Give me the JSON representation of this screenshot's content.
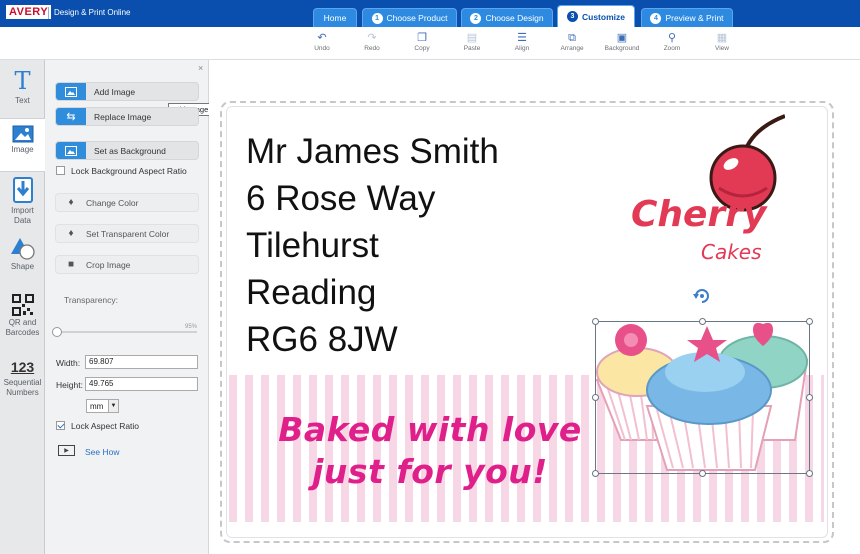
{
  "header": {
    "logo": "AVERY",
    "app_title": "Design & Print Online",
    "tabs": [
      {
        "label": "Home",
        "num": ""
      },
      {
        "label": "Choose Product",
        "num": "1"
      },
      {
        "label": "Choose Design",
        "num": "2"
      },
      {
        "label": "Customize",
        "num": "3"
      },
      {
        "label": "Preview & Print",
        "num": "4"
      }
    ]
  },
  "toolbar": {
    "undo": "Undo",
    "redo": "Redo",
    "copy": "Copy",
    "paste": "Paste",
    "align": "Align",
    "arrange": "Arrange",
    "background": "Background",
    "zoom": "Zoom",
    "view": "View"
  },
  "sidebar": {
    "text": "Text",
    "image": "Image",
    "import_line1": "Import",
    "import_line2": "Data",
    "shape": "Shape",
    "qr_line1": "QR and",
    "qr_line2": "Barcodes",
    "seq_line1": "Sequential",
    "seq_line2": "Numbers",
    "seq_glyph": "123"
  },
  "panel": {
    "close": "×",
    "add_image": "Add Image",
    "replace_image": "Replace Image",
    "set_background": "Set as Background",
    "lock_bg_ratio": "Lock Background Aspect Ratio",
    "change_color": "Change Color",
    "set_transparent": "Set Transparent Color",
    "crop_image": "Crop Image",
    "transparency_label": "Transparency:",
    "transparency_value": "95%",
    "width_label": "Width:",
    "width_value": "69.807",
    "height_label": "Height:",
    "height_value": "49.765",
    "unit": "mm",
    "lock_aspect": "Lock Aspect Ratio",
    "see_how": "See How",
    "tooltip": "Add Image"
  },
  "canvas": {
    "address": [
      "Mr James Smith",
      "6 Rose Way",
      "Tilehurst",
      "Reading",
      "RG6 8JW"
    ],
    "slogan_line1": "Baked with love",
    "slogan_line2": "just for you!",
    "brand_line1": "Cherry",
    "brand_line2": "Cakes"
  }
}
